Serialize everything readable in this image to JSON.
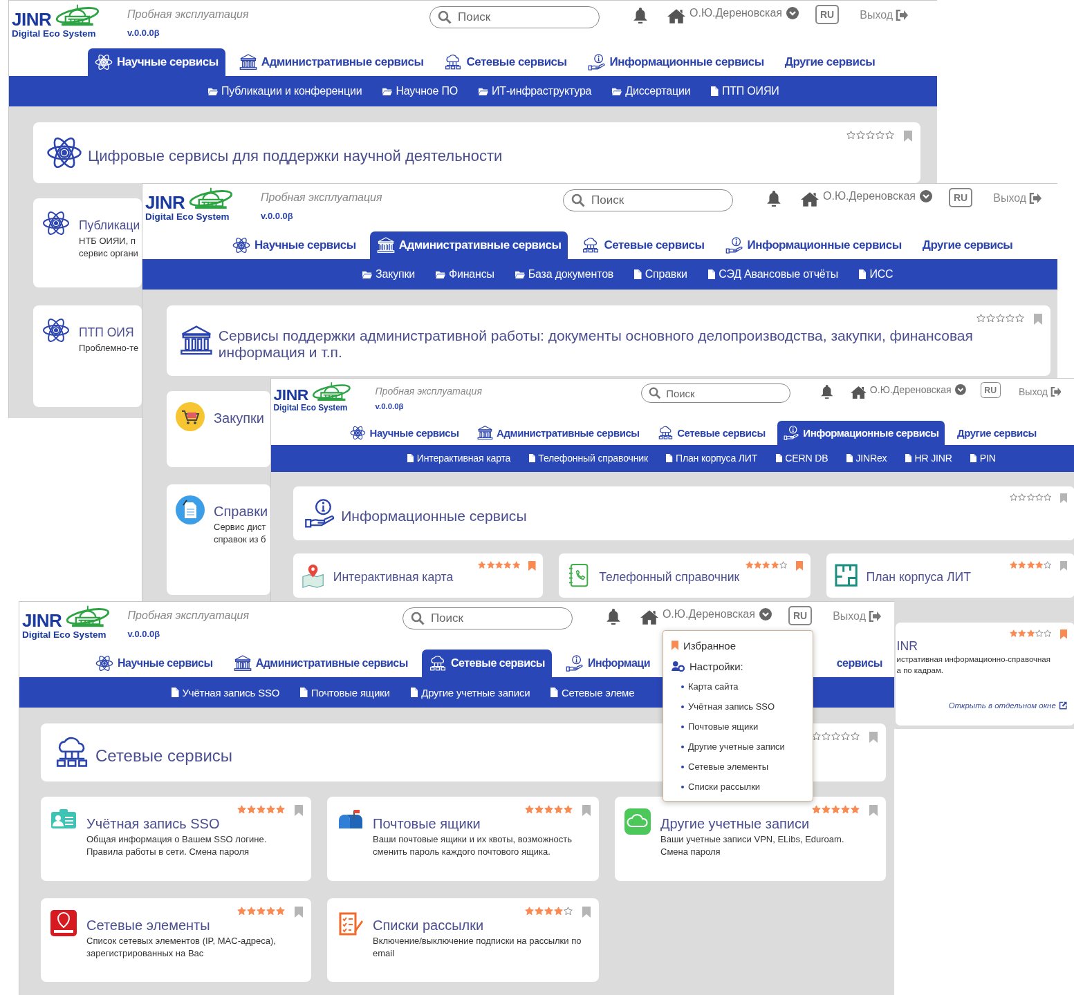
{
  "windows": [
    {
      "logo": {
        "title": "JINR",
        "subtitle": "Digital Eco System"
      },
      "notice": "Пробная эксплуатация",
      "version": "v.0.0.0β",
      "search": {
        "placeholder": "Поиск"
      },
      "user": "О.Ю.Дереновская",
      "language": "RU",
      "logout": "Выход",
      "tabs": [
        {
          "label": "Научные сервисы",
          "selected": true
        },
        {
          "label": "Административные сервисы",
          "selected": false
        },
        {
          "label": "Сетевые сервисы",
          "selected": false
        },
        {
          "label": "Информационные сервисы",
          "selected": false
        },
        {
          "label": "Другие сервисы",
          "selected": false
        }
      ],
      "subnav": [
        {
          "label": "Публикации и конференции",
          "kind": "folder"
        },
        {
          "label": "Научное ПО",
          "kind": "folder"
        },
        {
          "label": "ИТ-инфраструктура",
          "kind": "folder"
        },
        {
          "label": "Диссертации",
          "kind": "folder"
        },
        {
          "label": "ПТП ОИЯИ",
          "kind": "file"
        }
      ],
      "hero": {
        "title": "Цифровые сервисы для поддержки научной деятельности",
        "stars": 0,
        "bookmarked": false
      },
      "cards": [
        {
          "title": "Публикаци",
          "description": "НТБ ОИЯИ, п\nсервис органи"
        },
        {
          "title": "ПТП ОИЯ",
          "description": "Проблемно-те"
        }
      ]
    },
    {
      "logo": {
        "title": "JINR",
        "subtitle": "Digital Eco System"
      },
      "notice": "Пробная эксплуатация",
      "version": "v.0.0.0β",
      "search": {
        "placeholder": "Поиск"
      },
      "user": "О.Ю.Дереновская",
      "language": "RU",
      "logout": "Выход",
      "tabs": [
        {
          "label": "Научные сервисы",
          "selected": false
        },
        {
          "label": "Административные сервисы",
          "selected": true
        },
        {
          "label": "Сетевые сервисы",
          "selected": false
        },
        {
          "label": "Информационные сервисы",
          "selected": false
        },
        {
          "label": "Другие сервисы",
          "selected": false
        }
      ],
      "subnav": [
        {
          "label": "Закупки",
          "kind": "folder"
        },
        {
          "label": "Финансы",
          "kind": "folder"
        },
        {
          "label": "База документов",
          "kind": "folder"
        },
        {
          "label": "Справки",
          "kind": "file"
        },
        {
          "label": "СЭД Авансовые отчёты",
          "kind": "file"
        },
        {
          "label": "ИСС",
          "kind": "file"
        }
      ],
      "hero": {
        "title": "Сервисы поддержки административной работы: документы основного делопроизводства, закупки, финансовая информация и т.п.",
        "stars": 0,
        "bookmarked": false
      },
      "cards": [
        {
          "title": "Закупки"
        },
        {
          "title": "Справки",
          "description": "Сервис дист\nсправок из б"
        }
      ]
    },
    {
      "logo": {
        "title": "JINR",
        "subtitle": "Digital Eco System"
      },
      "notice": "Пробная эксплуатация",
      "version": "v.0.0.0β",
      "search": {
        "placeholder": "Поиск"
      },
      "user": "О.Ю.Дереновская",
      "language": "RU",
      "logout": "Выход",
      "tabs": [
        {
          "label": "Научные сервисы",
          "selected": false
        },
        {
          "label": "Административные сервисы",
          "selected": false
        },
        {
          "label": "Сетевые сервисы",
          "selected": false
        },
        {
          "label": "Информационные сервисы",
          "selected": true
        },
        {
          "label": "Другие сервисы",
          "selected": false
        }
      ],
      "subnav": [
        {
          "label": "Интерактивная карта",
          "kind": "file"
        },
        {
          "label": "Телефонный справочник",
          "kind": "file"
        },
        {
          "label": "План корпуса ЛИТ",
          "kind": "file"
        },
        {
          "label": "CERN DB",
          "kind": "file"
        },
        {
          "label": "JINRex",
          "kind": "file"
        },
        {
          "label": "HR JINR",
          "kind": "file"
        },
        {
          "label": "PIN",
          "kind": "file"
        }
      ],
      "hero": {
        "title": "Информационные сервисы",
        "stars": 0,
        "bookmarked": false
      },
      "cards": [
        {
          "title": "Интерактивная карта",
          "stars": 5,
          "bookmarked": true
        },
        {
          "title": "Телефонный справочник",
          "stars": 4,
          "bookmarked": true
        },
        {
          "title": "План корпуса ЛИТ",
          "stars": 4,
          "bookmarked": false
        },
        {
          "title": "INR",
          "description": "истративная информационно-справочная\nа по кадрам.",
          "stars": 3,
          "bookmarked": true,
          "link": "Открыть в отдельном окне"
        }
      ]
    },
    {
      "logo": {
        "title": "JINR",
        "subtitle": "Digital Eco System"
      },
      "notice": "Пробная эксплуатация",
      "version": "v.0.0.0β",
      "search": {
        "placeholder": "Поиск"
      },
      "user": "О.Ю.Дереновская",
      "language": "RU",
      "logout": "Выход",
      "tabs": [
        {
          "label": "Научные сервисы",
          "selected": false
        },
        {
          "label": "Административные сервисы",
          "selected": false
        },
        {
          "label": "Сетевые сервисы",
          "selected": true
        },
        {
          "label": "Информаци",
          "selected": false
        },
        {
          "label": "сервисы",
          "selected": false
        }
      ],
      "subnav": [
        {
          "label": "Учётная запись SSO",
          "kind": "file"
        },
        {
          "label": "Почтовые ящики",
          "kind": "file"
        },
        {
          "label": "Другие учетные записи",
          "kind": "file"
        },
        {
          "label": "Сетевые элеме",
          "kind": "file"
        }
      ],
      "hero": {
        "title": "Сетевые сервисы",
        "stars": 0,
        "bookmarked": false
      },
      "cards": [
        {
          "title": "Учётная запись SSO",
          "description": "Общая информация о Вашем SSO логине.\nПравила работы в сети. Смена пароля",
          "stars": 5,
          "bookmarked": false
        },
        {
          "title": "Почтовые ящики",
          "description": "Ваши почтовые ящики и их квоты, возможность\nсменить пароль каждого почтового ящика.",
          "stars": 5,
          "bookmarked": false
        },
        {
          "title": "Другие учетные записи",
          "description": "Ваши учетные записи VPN, ELibs, Eduroam.\nСмена пароля",
          "stars": 5,
          "bookmarked": false
        },
        {
          "title": "Сетевые элементы",
          "description": "Список сетевых элементов (IP, MAC-адреса),\nзарегистрированных на Вас",
          "stars": 5,
          "bookmarked": false
        },
        {
          "title": "Списки рассылки",
          "description": "Включение/выключение подписки на рассылки по\nemail",
          "stars": 4,
          "bookmarked": false
        }
      ],
      "menu": {
        "items": [
          {
            "label": "Избранное",
            "kind": "header"
          },
          {
            "label": "Настройки:",
            "kind": "header"
          },
          {
            "label": "Карта сайта",
            "kind": "link"
          },
          {
            "label": "Учётная запись SSO",
            "kind": "link"
          },
          {
            "label": "Почтовые ящики",
            "kind": "link"
          },
          {
            "label": "Другие учетные записи",
            "kind": "link"
          },
          {
            "label": "Сетевые элементы",
            "kind": "link"
          },
          {
            "label": "Списки рассылки",
            "kind": "link"
          }
        ]
      }
    }
  ]
}
